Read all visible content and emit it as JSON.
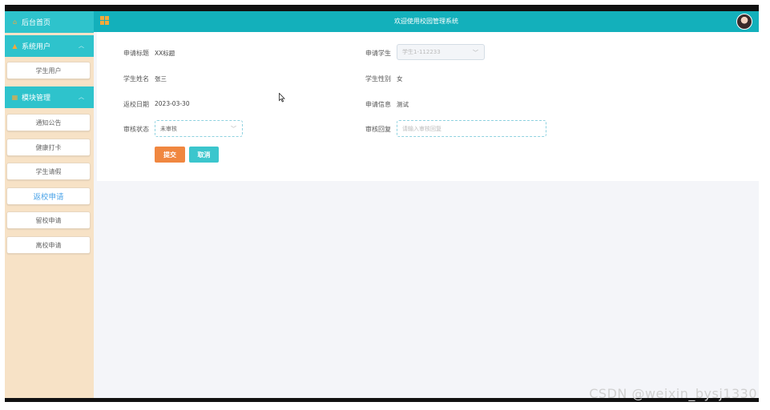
{
  "header": {
    "title": "欢迎使用校园管理系统"
  },
  "sidebar": {
    "home": "后台首页",
    "sections": [
      {
        "label": "系统用户",
        "items": [
          "学生用户"
        ]
      },
      {
        "label": "模块管理",
        "items": [
          "通知公告",
          "健康打卡",
          "学生请假",
          "返校申请",
          "留校申请",
          "离校申请"
        ]
      }
    ],
    "active_item": "返校申请"
  },
  "form": {
    "title_label": "申请标题",
    "title_value": "XX标题",
    "student_label": "申请学生",
    "student_value": "学生1-112233",
    "name_label": "学生姓名",
    "name_value": "张三",
    "gender_label": "学生性别",
    "gender_value": "女",
    "date_label": "返校日期",
    "date_value": "2023-03-30",
    "info_label": "申请信息",
    "info_value": "测试",
    "status_label": "审核状态",
    "status_value": "未审核",
    "reply_label": "审核回复",
    "reply_placeholder": "请输入审核回复",
    "submit_label": "提交",
    "cancel_label": "取消"
  },
  "icons": {
    "home": "home-icon",
    "user": "user-icon",
    "modules": "grid-icon",
    "chevron": "chevron-up-icon",
    "avatar": "avatar"
  },
  "colors": {
    "header": "#13b0bb",
    "nav": "#2ec3cc",
    "sidebar_bg": "#f7e2c6",
    "submit": "#f08740",
    "cancel": "#3bc6cd",
    "active_link": "#4aa3e8"
  },
  "watermark": "CSDN @weixin_bysj1330"
}
